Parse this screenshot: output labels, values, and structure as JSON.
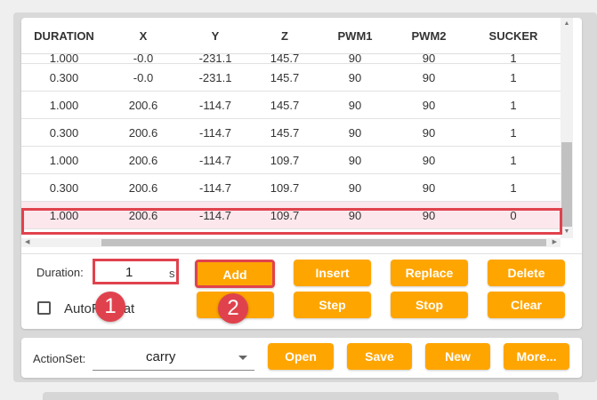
{
  "table": {
    "columns": [
      "DURATION",
      "X",
      "Y",
      "Z",
      "PWM1",
      "PWM2",
      "SUCKER"
    ],
    "rows": [
      [
        "1.000",
        "-0.0",
        "-231.1",
        "145.7",
        "90",
        "90",
        "1"
      ],
      [
        "0.300",
        "-0.0",
        "-231.1",
        "145.7",
        "90",
        "90",
        "1"
      ],
      [
        "1.000",
        "200.6",
        "-114.7",
        "145.7",
        "90",
        "90",
        "1"
      ],
      [
        "0.300",
        "200.6",
        "-114.7",
        "145.7",
        "90",
        "90",
        "1"
      ],
      [
        "1.000",
        "200.6",
        "-114.7",
        "109.7",
        "90",
        "90",
        "1"
      ],
      [
        "0.300",
        "200.6",
        "-114.7",
        "109.7",
        "90",
        "90",
        "1"
      ],
      [
        "1.000",
        "200.6",
        "-114.7",
        "109.7",
        "90",
        "90",
        "0"
      ]
    ],
    "selected_row_index": 6
  },
  "controls": {
    "duration_label": "Duration:",
    "duration_value": "1",
    "duration_unit": "s",
    "autorepeat_label": "AutoRepeat",
    "autorepeat_checked": false,
    "buttons": {
      "add": "Add",
      "insert": "Insert",
      "replace": "Replace",
      "delete": "Delete",
      "step": "Step",
      "stop": "Stop",
      "clear": "Clear"
    }
  },
  "annotations": {
    "badge_1": "1",
    "badge_2": "2",
    "highlight_color": "#e0424d"
  },
  "actionset": {
    "label": "ActionSet:",
    "selected": "carry",
    "buttons": {
      "open": "Open",
      "save": "Save",
      "new": "New",
      "more": "More..."
    }
  },
  "theme": {
    "button_color": "#ffa500",
    "selected_row_bg": "#fbe7ec"
  }
}
